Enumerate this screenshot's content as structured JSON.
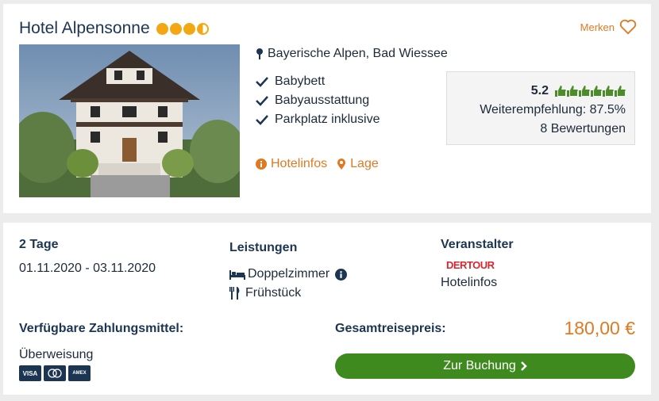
{
  "hotel": {
    "name": "Hotel Alpensonne",
    "stars": 3.5,
    "location": "Bayerische Alpen, Bad Wiessee",
    "features": [
      "Babybett",
      "Babyausstattung",
      "Parkplatz inklusive"
    ],
    "links": {
      "hotelinfos": "Hotelinfos",
      "lage": "Lage"
    },
    "save_label": "Merken"
  },
  "rating": {
    "score": "5.2",
    "thumbs_filled": 6,
    "thumbs_total": 6,
    "recommendation": "Weiterempfehlung: 87.5%",
    "reviews": "8 Bewertungen"
  },
  "offer": {
    "duration": "2 Tage",
    "dates": "01.11.2020 - 03.11.2020",
    "services_label": "Leistungen",
    "room": "Doppelzimmer",
    "board": "Frühstück",
    "operator_label": "Veranstalter",
    "operator_logo": "DERTOUR",
    "operator_link": "Hotelinfos",
    "payment_label": "Verfügbare Zahlungsmittel:",
    "payment_method": "Überweisung",
    "payment_icons": [
      "VISA",
      "MC",
      "AMEX"
    ],
    "total_label": "Gesamtreisepreis:",
    "price": "180,00 €",
    "book_label": "Zur Buchung"
  },
  "colors": {
    "accent": "#e07a22",
    "primary": "#1c3553",
    "book": "#3e8a1f",
    "star": "#f3a712",
    "thumb": "#4c8c2a"
  }
}
